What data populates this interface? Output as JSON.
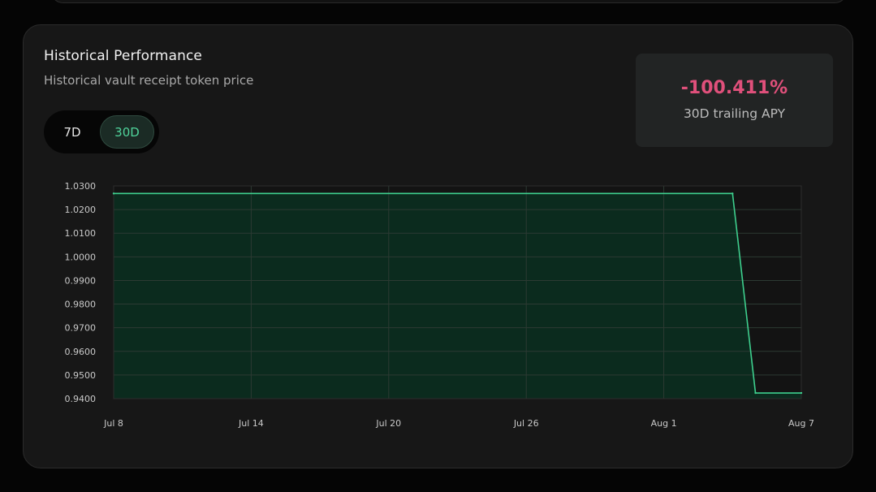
{
  "header": {
    "title": "Historical Performance",
    "subtitle": "Historical vault receipt token price"
  },
  "range_toggle": {
    "options": [
      "7D",
      "30D"
    ],
    "selected": "30D"
  },
  "apy": {
    "value": "-100.411%",
    "label": "30D trailing APY"
  },
  "colors": {
    "accent_green": "#4fd29a",
    "line_green": "#3ecf8e",
    "area_fill": "#0b2b1e",
    "negative": "#e0507b"
  },
  "chart_data": {
    "type": "area",
    "x_tick_labels": [
      "Jul 8",
      "Jul 14",
      "Jul 20",
      "Jul 26",
      "Aug 1",
      "Aug 7"
    ],
    "y_tick_labels": [
      "1.0300",
      "1.0200",
      "1.0100",
      "1.0000",
      "0.9900",
      "0.9800",
      "0.9700",
      "0.9600",
      "0.9500",
      "0.9400"
    ],
    "xlim": [
      "2024-07-08",
      "2024-08-07"
    ],
    "ylim": [
      0.94,
      1.03
    ],
    "x_gridlines": [
      "2024-07-08",
      "2024-07-14",
      "2024-07-20",
      "2024-07-26",
      "2024-08-01",
      "2024-08-07"
    ],
    "series": [
      {
        "points": [
          {
            "x": "2024-07-08",
            "y": 1.0268
          },
          {
            "x": "2024-08-04",
            "y": 1.0268
          },
          {
            "x": "2024-08-05",
            "y": 0.9424
          },
          {
            "x": "2024-08-07",
            "y": 0.9424
          }
        ]
      }
    ],
    "grid": true
  }
}
